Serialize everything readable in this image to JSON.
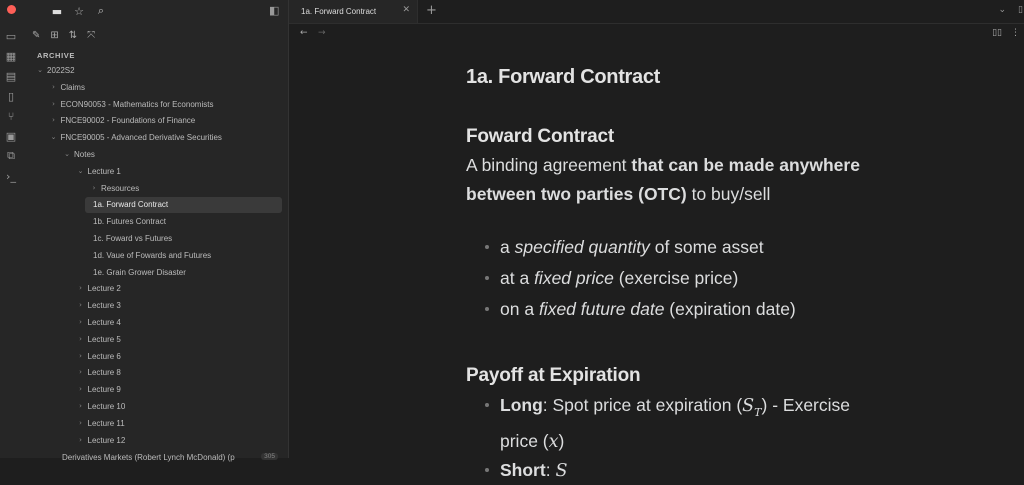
{
  "colors": {
    "close": "#fe5f57",
    "minimize": "#febc2e",
    "maximize": "#28c840",
    "accent_bg": "#3a3a3a"
  },
  "ribbon": {
    "icons": [
      "presentation-icon",
      "table-icon",
      "layout-icon",
      "file-icon",
      "graph-icon",
      "calendar-icon",
      "copy-icon",
      "terminal-icon"
    ]
  },
  "sidebar": {
    "vault_label": "ARCHIVE",
    "tree": [
      {
        "label": "2022S2",
        "level": 0,
        "chev": "⌄"
      },
      {
        "label": "Claims",
        "level": 1,
        "chev": "›"
      },
      {
        "label": "ECON90053 - Mathematics for Economists",
        "level": 1,
        "chev": "›"
      },
      {
        "label": "FNCE90002 - Foundations of Finance",
        "level": 1,
        "chev": "›"
      },
      {
        "label": "FNCE90005 - Advanced Derivative Securities",
        "level": 1,
        "chev": "⌄"
      },
      {
        "label": "Notes",
        "level": 2,
        "chev": "⌄"
      },
      {
        "label": "Lecture 1",
        "level": 3,
        "chev": "⌄"
      },
      {
        "label": "Resources",
        "level": 4,
        "chev": "›"
      },
      {
        "label": "1a. Forward Contract",
        "level": 4,
        "chev": "",
        "selected": true
      },
      {
        "label": "1b. Futures Contract",
        "level": 4,
        "chev": ""
      },
      {
        "label": "1c. Foward vs Futures",
        "level": 4,
        "chev": ""
      },
      {
        "label": "1d. Vaue of Fowards and Futures",
        "level": 4,
        "chev": ""
      },
      {
        "label": "1e. Grain Grower Disaster",
        "level": 4,
        "chev": ""
      },
      {
        "label": "Lecture 2",
        "level": 3,
        "chev": "›"
      },
      {
        "label": "Lecture 3",
        "level": 3,
        "chev": "›"
      },
      {
        "label": "Lecture 4",
        "level": 3,
        "chev": "›"
      },
      {
        "label": "Lecture 5",
        "level": 3,
        "chev": "›"
      },
      {
        "label": "Lecture 6",
        "level": 3,
        "chev": "›"
      },
      {
        "label": "Lecture 8",
        "level": 3,
        "chev": "›"
      },
      {
        "label": "Lecture 9",
        "level": 3,
        "chev": "›"
      },
      {
        "label": "Lecture 10",
        "level": 3,
        "chev": "›"
      },
      {
        "label": "Lecture 11",
        "level": 3,
        "chev": "›"
      },
      {
        "label": "Lecture 12",
        "level": 3,
        "chev": "›"
      }
    ],
    "cut_label": "Derivatives Markets (Robert Lynch McDonald) (p",
    "cut_badge": "305"
  },
  "tab": {
    "title": "1a. Forward Contract",
    "close": "✕",
    "plus": "+"
  },
  "doc": {
    "title": "1a. Forward Contract",
    "h2_forward": "Foward Contract",
    "p_pre": "A binding agreement ",
    "p_bold": "that can be made anywhere between two parties (OTC)",
    "p_post": " to buy/sell",
    "bullets": [
      {
        "pre": "a ",
        "em": "specified quantity",
        "post": " of some asset"
      },
      {
        "pre": "at a ",
        "em": "fixed price",
        "post": " (exercise price)"
      },
      {
        "pre": "on a ",
        "em": "fixed future date",
        "post": " (expiration date)"
      }
    ],
    "h2_payoff": "Payoff at Expiration",
    "payoff": [
      {
        "bold": "Long",
        "text": ": Spot price at expiration (",
        "math": "S",
        "sub": "T",
        "tail": ") - Exercise price (",
        "math2": "x",
        "end": ")"
      },
      {
        "bold": "Short",
        "text": ": ",
        "math": "S",
        "sub": "",
        "tail": "",
        "math2": "",
        "end": ""
      }
    ]
  }
}
